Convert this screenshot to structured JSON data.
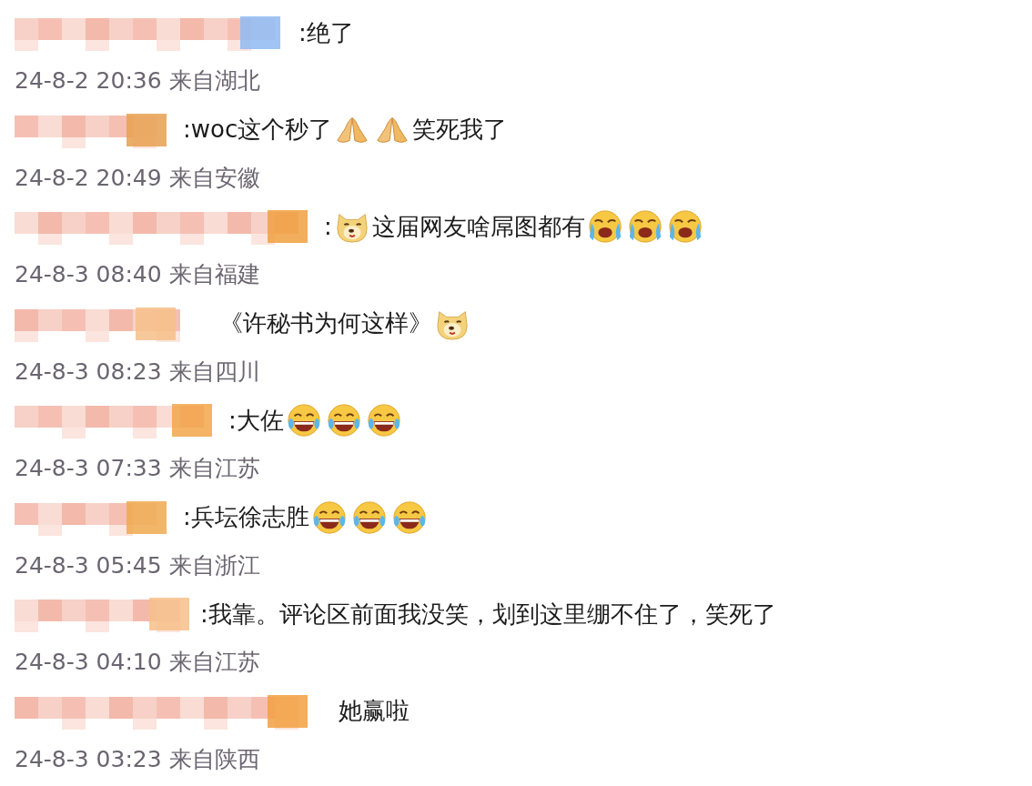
{
  "comments": [
    {
      "parts": [
        {
          "kind": "text",
          "text": ":绝了"
        }
      ],
      "meta": "24-8-2 20:36 来自湖北"
    },
    {
      "parts": [
        {
          "kind": "text",
          "text": ":woc这个秒了"
        },
        {
          "kind": "pray"
        },
        {
          "kind": "pray"
        },
        {
          "kind": "text",
          "text": "笑死我了"
        }
      ],
      "meta": "24-8-2 20:49 来自安徽"
    },
    {
      "parts": [
        {
          "kind": "text",
          "text": ":"
        },
        {
          "kind": "doge"
        },
        {
          "kind": "text",
          "text": "这届网友啥屌图都有"
        },
        {
          "kind": "sob"
        },
        {
          "kind": "sob"
        },
        {
          "kind": "sob"
        }
      ],
      "meta": "24-8-3 08:40 来自福建"
    },
    {
      "parts": [
        {
          "kind": "text",
          "text": "《许秘书为何这样》"
        },
        {
          "kind": "doge"
        }
      ],
      "meta": "24-8-3 08:23 来自四川"
    },
    {
      "parts": [
        {
          "kind": "text",
          "text": ":大佐"
        },
        {
          "kind": "laugh"
        },
        {
          "kind": "laugh"
        },
        {
          "kind": "laugh"
        }
      ],
      "meta": "24-8-3 07:33 来自江苏"
    },
    {
      "parts": [
        {
          "kind": "text",
          "text": ":兵坛徐志胜"
        },
        {
          "kind": "laugh"
        },
        {
          "kind": "laugh"
        },
        {
          "kind": "laugh"
        }
      ],
      "meta": "24-8-3 05:45 来自浙江"
    },
    {
      "parts": [
        {
          "kind": "text",
          "text": ":我靠。评论区前面我没笑，划到这里绷不住了，笑死了"
        }
      ],
      "meta": "24-8-3 04:10 来自江苏"
    },
    {
      "parts": [
        {
          "kind": "text",
          "text": "她赢啦"
        }
      ],
      "meta": "24-8-3 03:23 来自陕西"
    }
  ]
}
